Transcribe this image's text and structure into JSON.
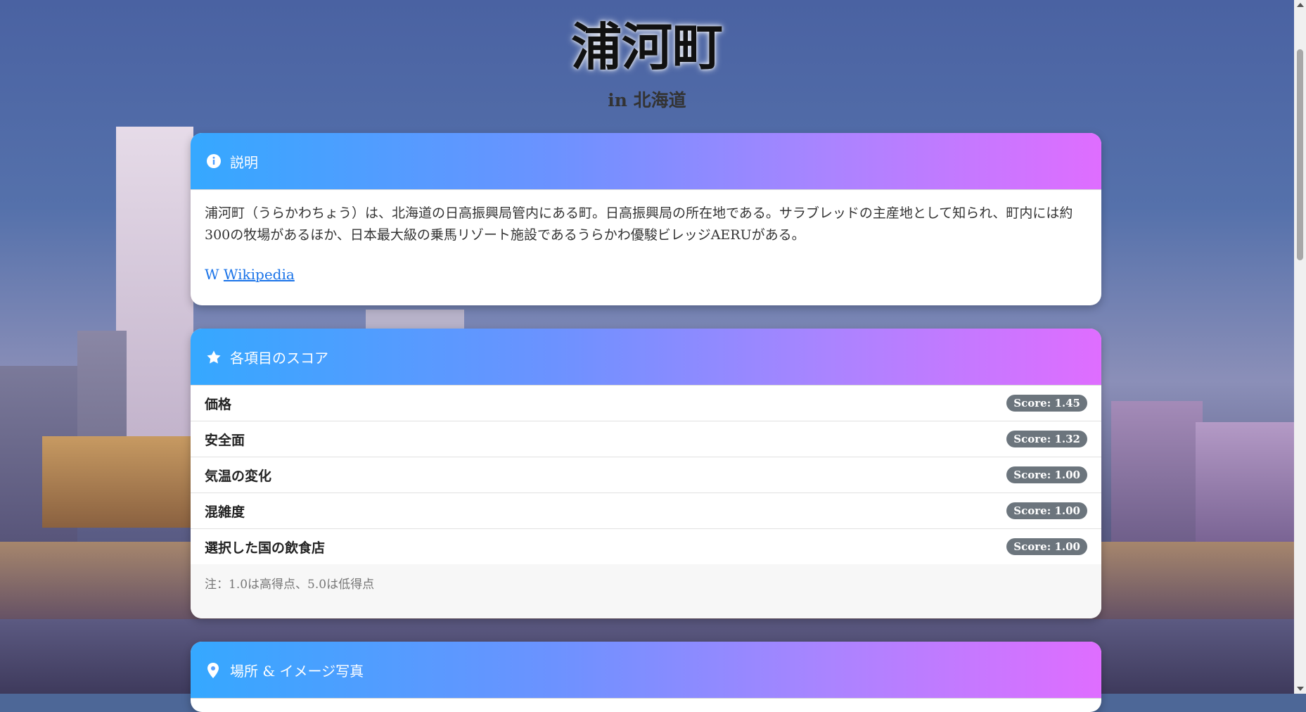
{
  "page": {
    "title": "浦河町",
    "subtitle": "in 北海道"
  },
  "description": {
    "header": "説明",
    "icon": "info-circle-icon",
    "text": "浦河町（うらかわちょう）は、北海道の日高振興局管内にある町。日高振興局の所在地である。サラブレッドの主産地として知られ、町内には約300の牧場があるほか、日本最大級の乗馬リゾート施設であるうらかわ優駿ビレッジAERUがある。",
    "wiki_icon": "W",
    "wiki_label": "Wikipedia"
  },
  "scores": {
    "header": "各項目のスコア",
    "icon": "star-icon",
    "items": [
      {
        "label": "価格",
        "score": "Score: 1.45"
      },
      {
        "label": "安全面",
        "score": "Score: 1.32"
      },
      {
        "label": "気温の変化",
        "score": "Score: 1.00"
      },
      {
        "label": "混雑度",
        "score": "Score: 1.00"
      },
      {
        "label": "選択した国の飲食店",
        "score": "Score: 1.00"
      }
    ],
    "note": "注：1.0は高得点、5.0は低得点"
  },
  "location": {
    "header": "場所 & イメージ写真",
    "icon": "map-pin-icon"
  },
  "colors": {
    "header_gradient_start": "#35a8ff",
    "header_gradient_end": "#df6dff",
    "badge": "#6c757d",
    "link": "#1a73e8"
  }
}
